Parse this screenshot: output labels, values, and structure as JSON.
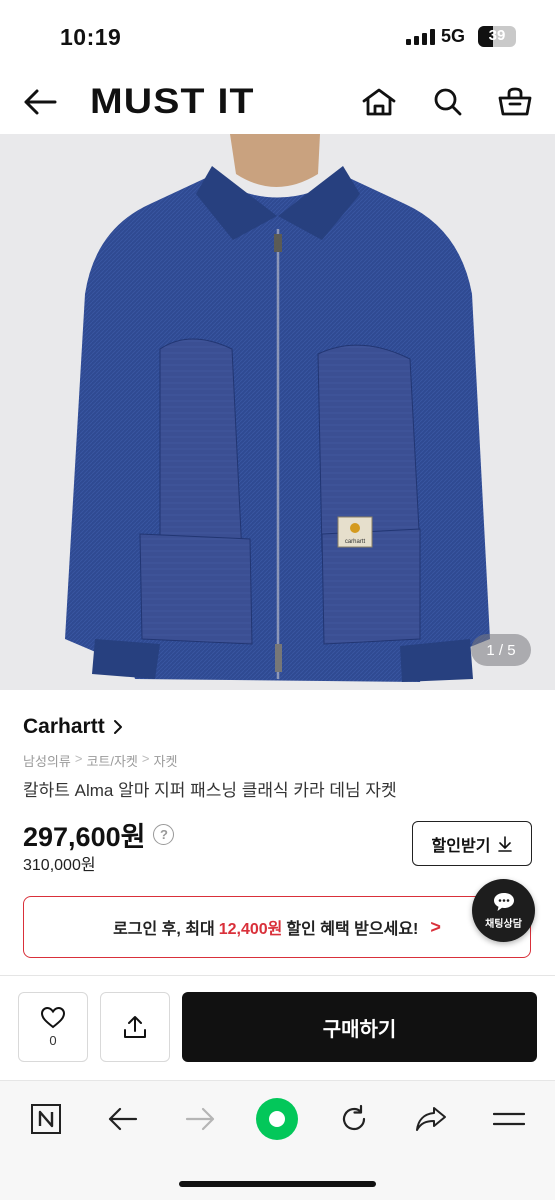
{
  "status_bar": {
    "time": "10:19",
    "network": "5G",
    "battery": "39"
  },
  "header": {
    "logo": "MUST IT",
    "icons": [
      "back-arrow-icon",
      "home-icon",
      "search-icon",
      "cart-icon"
    ]
  },
  "gallery": {
    "counter": "1 / 5",
    "current": 1,
    "total": 5,
    "label_text": "carhartt"
  },
  "product": {
    "brand": "Carhartt",
    "breadcrumb": [
      "남성의류",
      "코트/자켓",
      "자켓"
    ],
    "title": "칼하트 Alma 알마 지퍼 패스닝 클래식 카라 데님 자켓",
    "price": "297,600원",
    "original_price": "310,000원",
    "coupon_button": "할인받기"
  },
  "login_banner": {
    "prefix": "로그인 후, 최대",
    "amount": "12,400원",
    "suffix": "할인 혜택 받으세요!"
  },
  "chat_button": {
    "label": "채팅상담"
  },
  "actions": {
    "like_count": "0",
    "buy_label": "구매하기"
  },
  "browser_toolbar": {
    "icons": [
      "naver-n-icon",
      "back-icon",
      "forward-icon",
      "green-home-icon",
      "reload-icon",
      "share-icon",
      "menu-icon"
    ]
  },
  "colors": {
    "accent_red": "#d9303a",
    "primary_black": "#111111",
    "naver_green": "#03c75a",
    "denim": "#2d4890"
  }
}
